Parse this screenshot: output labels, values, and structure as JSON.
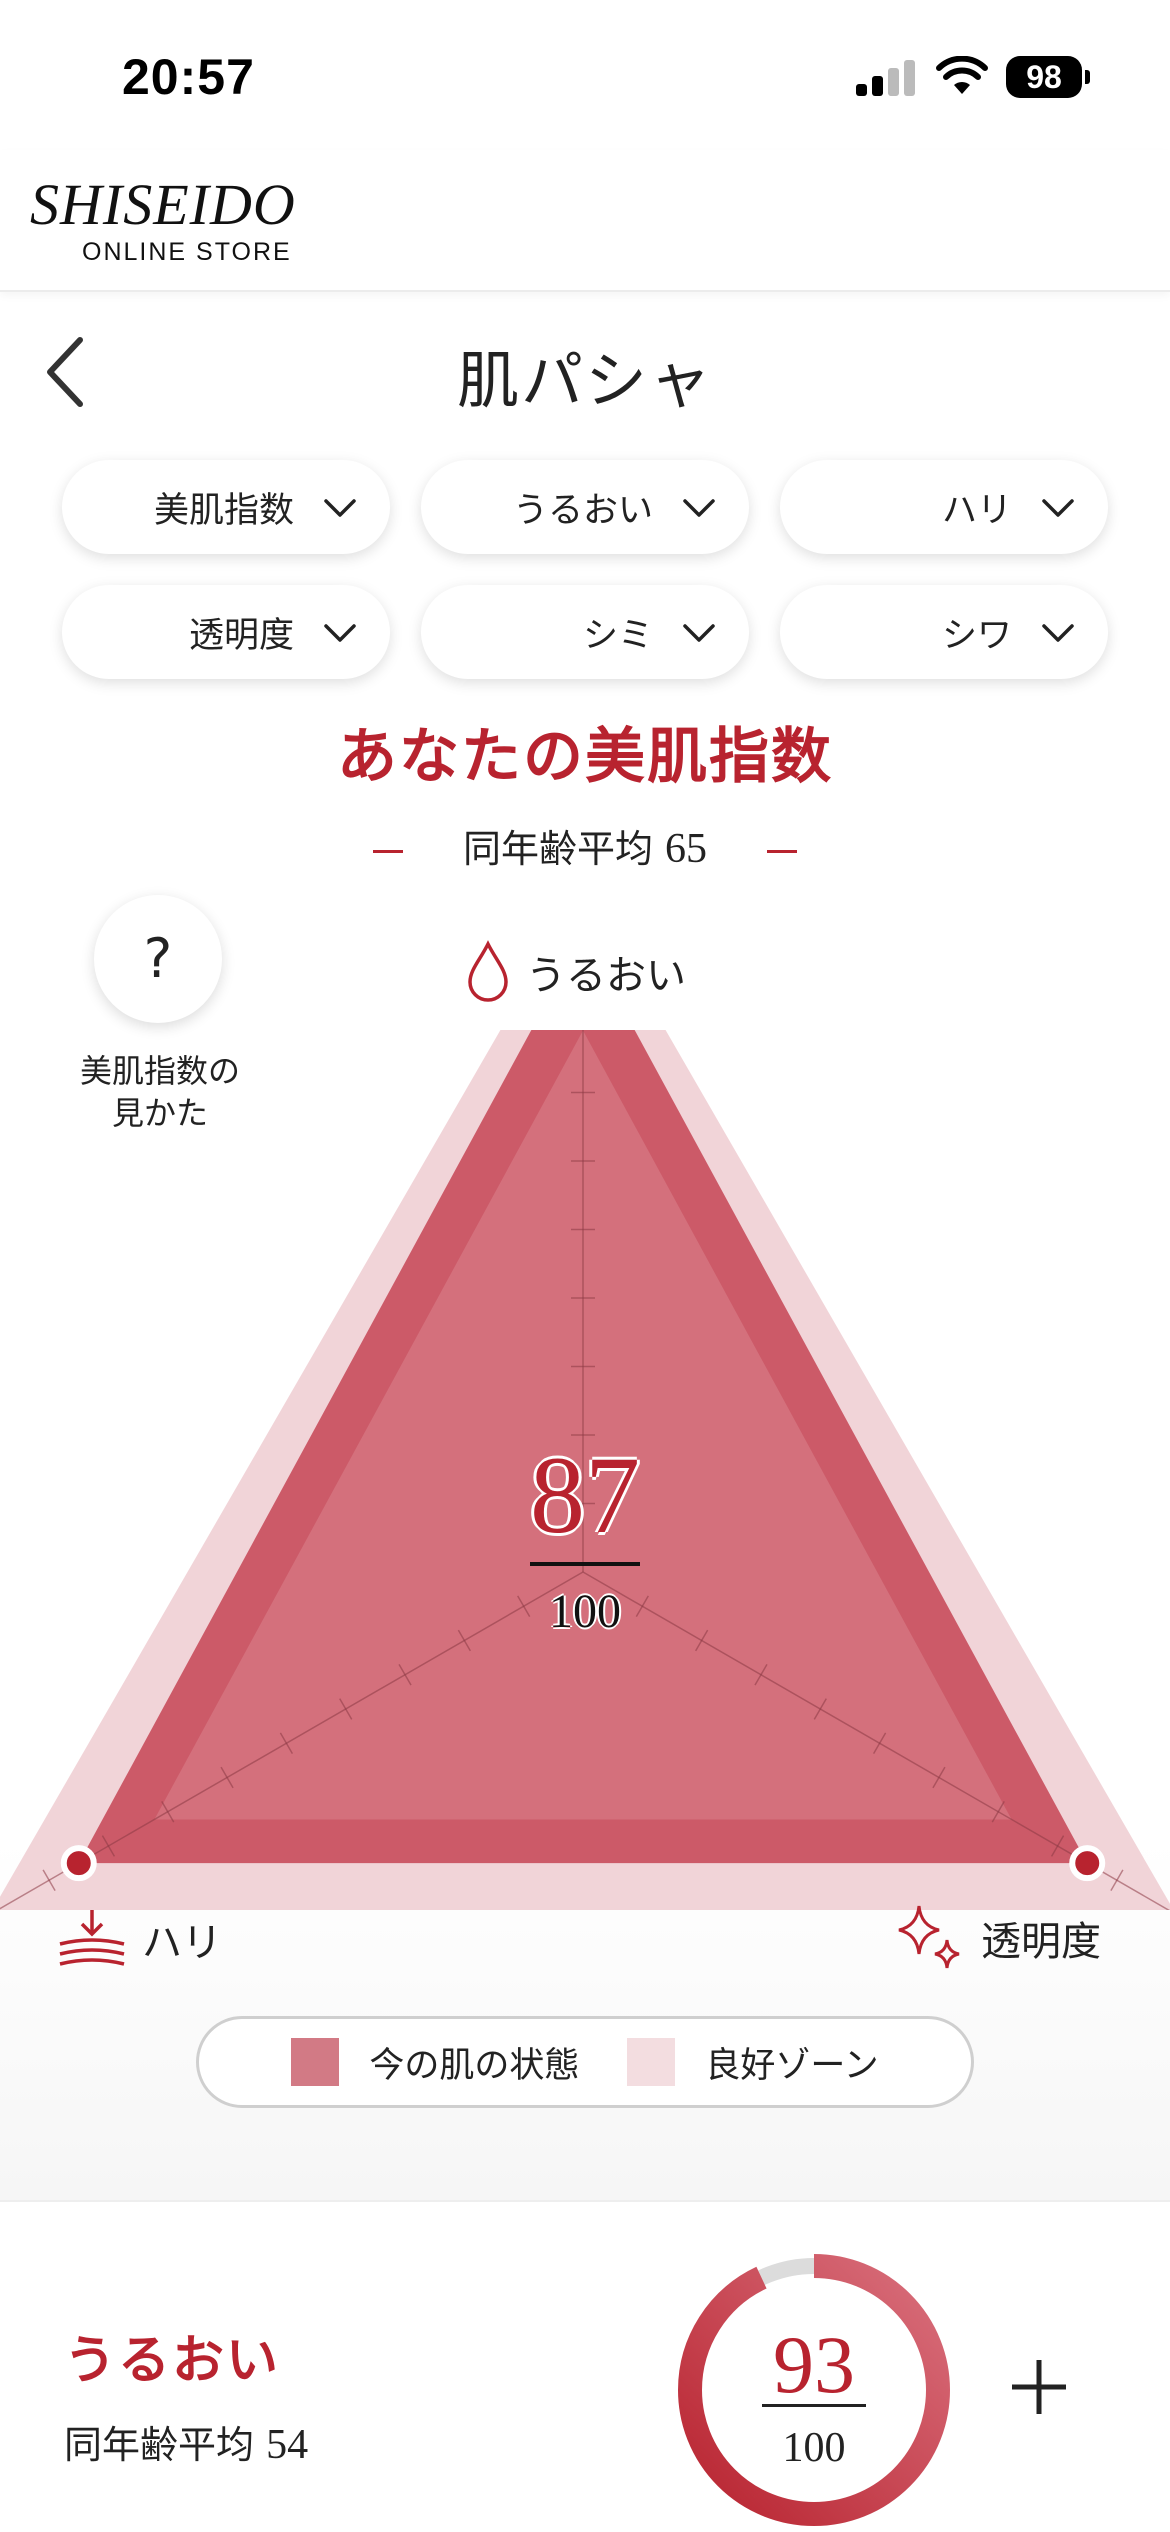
{
  "status_bar": {
    "time": "20:57",
    "battery": "98"
  },
  "header": {
    "logo_main": "SHISEIDO",
    "logo_sub": "ONLINE STORE"
  },
  "page": {
    "title": "肌パシャ"
  },
  "pills": [
    {
      "label": "美肌指数"
    },
    {
      "label": "うるおい"
    },
    {
      "label": "ハリ"
    },
    {
      "label": "透明度"
    },
    {
      "label": "シミ"
    },
    {
      "label": "シワ"
    }
  ],
  "summary": {
    "title": "あなたの美肌指数",
    "avg_label": "同年齢平均",
    "avg_value": "65"
  },
  "help": {
    "icon": "?",
    "label_line1": "美肌指数の",
    "label_line2": "見かた"
  },
  "chart_data": {
    "type": "radar",
    "axes": [
      {
        "name": "うるおい",
        "icon": "drop-icon"
      },
      {
        "name": "ハリ",
        "icon": "lift-icon"
      },
      {
        "name": "透明度",
        "icon": "sparkle-icon"
      }
    ],
    "series": [
      {
        "name": "今の肌の状態",
        "values": [
          93,
          85,
          85
        ],
        "color": "#cc5a68"
      },
      {
        "name": "良好ゾーン",
        "values": [
          100,
          100,
          100
        ],
        "color": "#f1d4d8"
      }
    ],
    "ticks": 10,
    "range": [
      0,
      100
    ],
    "score": "87",
    "score_max": "100"
  },
  "legend": [
    {
      "label": "今の肌の状態",
      "color": "#d27a85"
    },
    {
      "label": "良好ゾーン",
      "color": "#f3dde0"
    }
  ],
  "detail_card": {
    "title": "うるおい",
    "avg_label": "同年齢平均",
    "avg_value": "54",
    "score": "93",
    "score_max": "100",
    "score_value": 93
  },
  "colors": {
    "accent": "#b8232f",
    "zone": "#f1d4d8",
    "current": "#cc5a68"
  }
}
